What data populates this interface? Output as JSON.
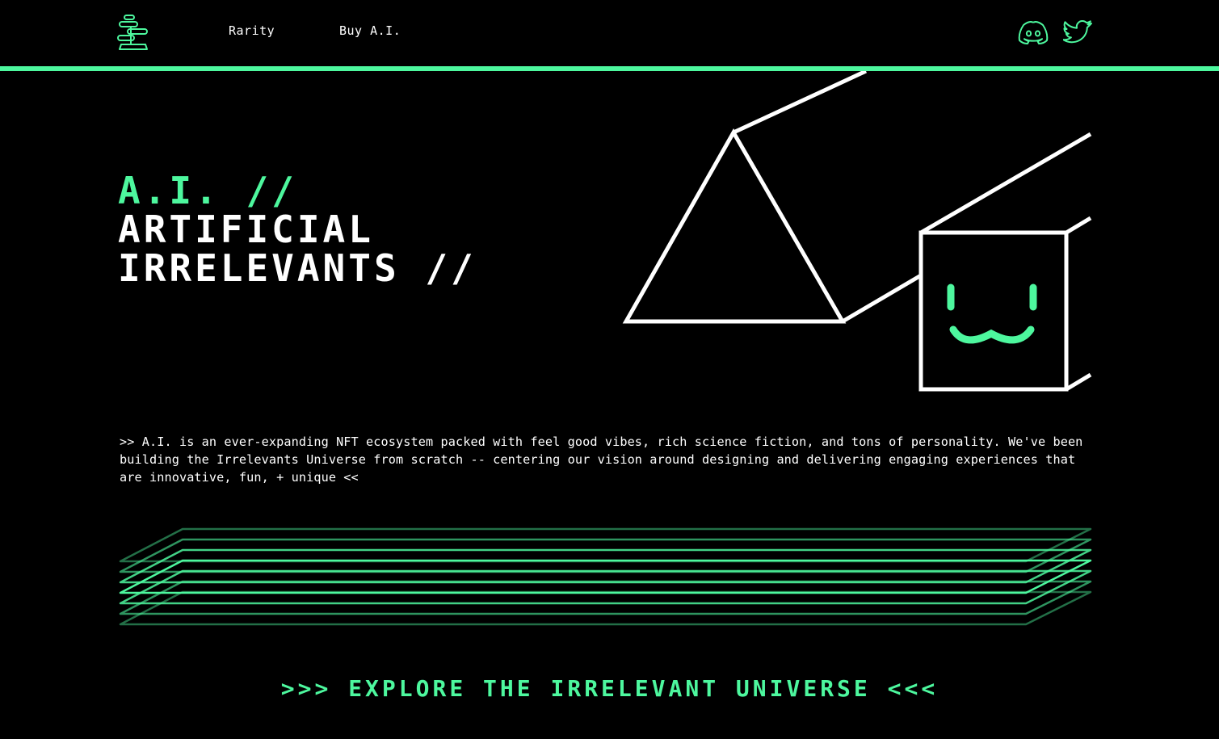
{
  "header": {
    "logo_icon": "bonsai-tree-icon",
    "nav": [
      {
        "label": "Rarity"
      },
      {
        "label": "Buy A.I."
      }
    ],
    "social": [
      {
        "icon": "discord-icon"
      },
      {
        "icon": "twitter-icon"
      }
    ]
  },
  "hero": {
    "title_line1": "A.I. //",
    "title_line2": "ARTIFICIAL",
    "title_line3": "IRRELEVANTS //",
    "description": ">> A.I. is an ever-expanding NFT ecosystem packed with feel good vibes, rich science fiction, and tons of personality. We've been building the Irrelevants Universe from scratch -- centering our vision around designing and delivering engaging experiences that are innovative, fun, + unique <<"
  },
  "cta": {
    "label": ">>> EXPLORE THE IRRELEVANT UNIVERSE <<<"
  },
  "colors": {
    "accent": "#4df79e",
    "background": "#000000",
    "text": "#ffffff"
  }
}
